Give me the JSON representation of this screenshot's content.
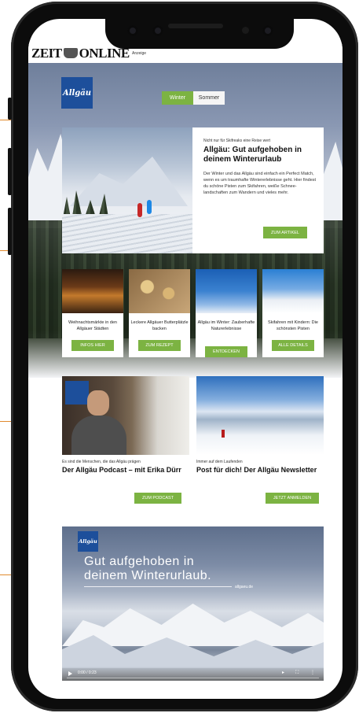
{
  "masthead": {
    "logo_left": "ZEIT",
    "logo_right": "ONLINE",
    "ad_label": "Anzeige"
  },
  "brand": {
    "logo_text": "Allgäu"
  },
  "season_toggle": {
    "options": [
      "Winter",
      "Sommer"
    ],
    "selected": "Winter"
  },
  "feature": {
    "kicker": "Nicht nur für Skifreaks eine Reise wert",
    "title": "Allgäu: Gut aufgehoben in deinem Winterurlaub",
    "body": "Der Winter und das Allgäu sind einfach ein Perfect Match, wenn es um traumhafte Wintererlebnisse geht. Hier findest du schöne Pisten zum Skifahren, weiße Schnee-landschaften zum Wandern und vieles mehr.",
    "button": "ZUM ARTIKEL"
  },
  "cards": [
    {
      "caption": "Weihnachtsmärkte in den Allgäuer Städten",
      "button": "INFOS HIER"
    },
    {
      "caption": "Leckere Allgäuer Butterplätzle backen",
      "button": "ZUM REZEPT"
    },
    {
      "caption": "Allgäu im Winter: Zauberhafte Naturerlebnisse",
      "button": "ENTDECKEN"
    },
    {
      "caption": "Skifahren mit Kindern: Die schönsten Pisten",
      "button": "ALLE DETAILS"
    }
  ],
  "podcast": {
    "kicker": "Es sind die Menschen, die das Allgäu prägen",
    "title": "Der Allgäu Podcast – mit Erika Dürr",
    "button": "ZUM PODCAST"
  },
  "newsletter": {
    "kicker": "Immer auf dem Laufenden",
    "title": "Post für dich! Der Allgäu Newsletter",
    "button": "JETZT ANMELDEN"
  },
  "video": {
    "logo_text": "Allgäu",
    "headline": "Gut aufgehoben in deinem Winterurlaub.",
    "url": "allgaeu.de",
    "time": "0:00 / 0:23"
  },
  "colors": {
    "accent": "#7cb342",
    "brand_blue": "#1d4f9b",
    "callout": "#e08a2e"
  }
}
